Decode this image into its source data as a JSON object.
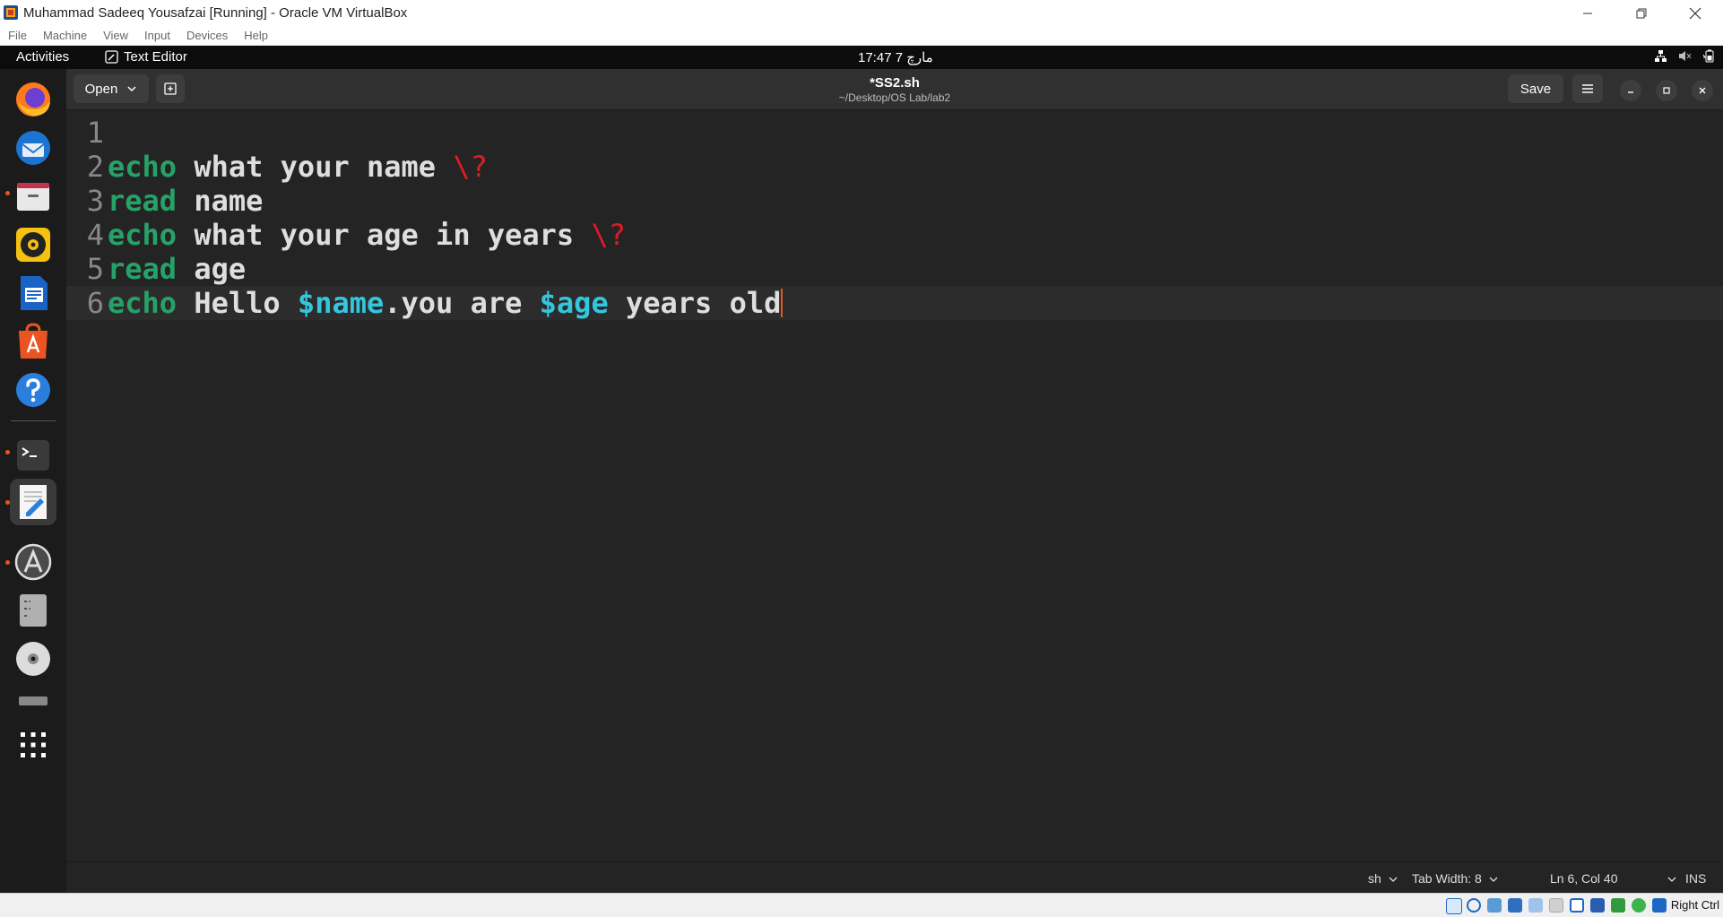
{
  "host": {
    "title": "Muhammad Sadeeq Yousafzai [Running] - Oracle VM VirtualBox",
    "menu": [
      "File",
      "Machine",
      "View",
      "Input",
      "Devices",
      "Help"
    ],
    "host_key": "Right Ctrl"
  },
  "guest_topbar": {
    "activities": "Activities",
    "app_name": "Text Editor",
    "clock": "17:47  7 مارچ"
  },
  "dock": {
    "items": [
      "firefox-icon",
      "thunderbird-icon",
      "files-icon",
      "rhythmbox-icon",
      "writer-icon",
      "app-center-icon",
      "help-icon",
      "terminal-icon",
      "text-editor-icon",
      "software-updater-icon",
      "disk-icon",
      "optical-disc-icon",
      "show-apps-icon"
    ]
  },
  "editor": {
    "open_label": "Open",
    "save_label": "Save",
    "file_title": "*SS2.sh",
    "file_path": "~/Desktop/OS Lab/lab2",
    "lines": [
      {
        "n": "1",
        "parts": []
      },
      {
        "n": "2",
        "parts": [
          {
            "t": "echo",
            "c": "kw"
          },
          {
            "t": " what your name ",
            "c": ""
          },
          {
            "t": "\\?",
            "c": "esc"
          }
        ]
      },
      {
        "n": "3",
        "parts": [
          {
            "t": "read",
            "c": "kw"
          },
          {
            "t": " name",
            "c": ""
          }
        ]
      },
      {
        "n": "4",
        "parts": [
          {
            "t": "echo",
            "c": "kw"
          },
          {
            "t": " what your age in years ",
            "c": ""
          },
          {
            "t": "\\?",
            "c": "esc"
          }
        ]
      },
      {
        "n": "5",
        "parts": [
          {
            "t": "read",
            "c": "kw"
          },
          {
            "t": " age",
            "c": ""
          }
        ]
      },
      {
        "n": "6",
        "parts": [
          {
            "t": "echo",
            "c": "kw"
          },
          {
            "t": " Hello ",
            "c": ""
          },
          {
            "t": "$name",
            "c": "var"
          },
          {
            "t": ".you are ",
            "c": ""
          },
          {
            "t": "$age",
            "c": "var"
          },
          {
            "t": " years old",
            "c": ""
          }
        ]
      }
    ],
    "current_line": 6
  },
  "statusbar": {
    "language": "sh",
    "tab_width": "Tab Width: 8",
    "cursor_pos": "Ln 6, Col 40",
    "mode": "INS"
  },
  "colors": {
    "accent": "#e95420",
    "keyword": "#26a269",
    "variable": "#33c7de",
    "escape": "#e01b24"
  }
}
